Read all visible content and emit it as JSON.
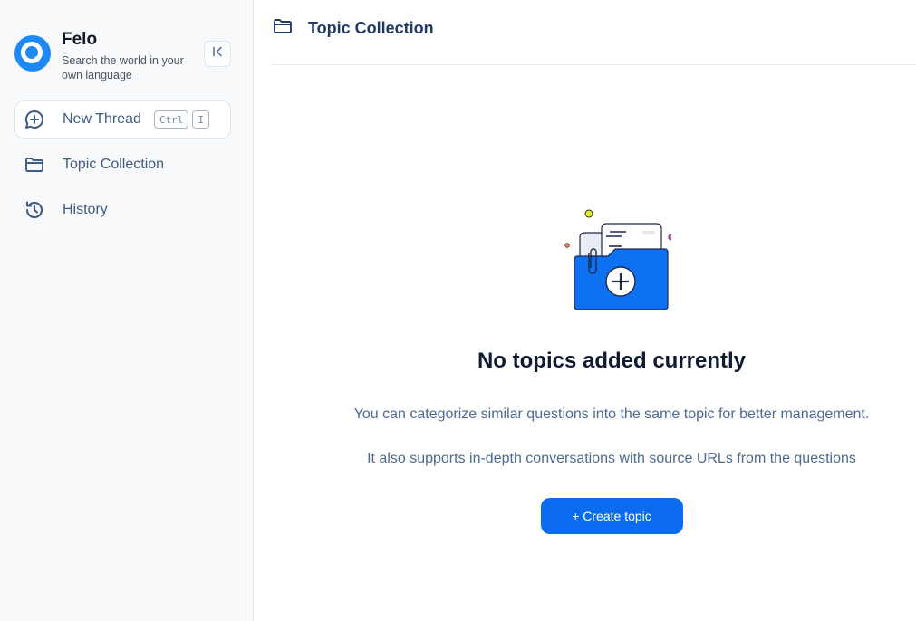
{
  "brand": {
    "name": "Felo",
    "tagline": "Search the world in your own language",
    "logo_icon": "q-search-logo"
  },
  "sidebar": {
    "collapse_icon": "collapse-left-icon",
    "items": [
      {
        "label": "New Thread",
        "icon": "chat-plus-icon",
        "shortcut": [
          "Ctrl",
          "I"
        ]
      },
      {
        "label": "Topic Collection",
        "icon": "folder-icon"
      },
      {
        "label": "History",
        "icon": "history-icon"
      }
    ]
  },
  "header": {
    "title": "Topic Collection",
    "icon": "folder-icon"
  },
  "empty_state": {
    "illustration": "folder-plus-illustration",
    "title": "No topics added currently",
    "description": "You can categorize similar questions into the same topic for better management.",
    "description2": "It also supports in-depth conversations with source URLs from the questions",
    "button_label": "+ Create topic"
  },
  "colors": {
    "accent": "#0b6cf0",
    "logo": "#1e88f5",
    "sidebar_bg": "#f8f9fb",
    "nav_text": "#3f5a83",
    "heading": "#1f3a66"
  }
}
